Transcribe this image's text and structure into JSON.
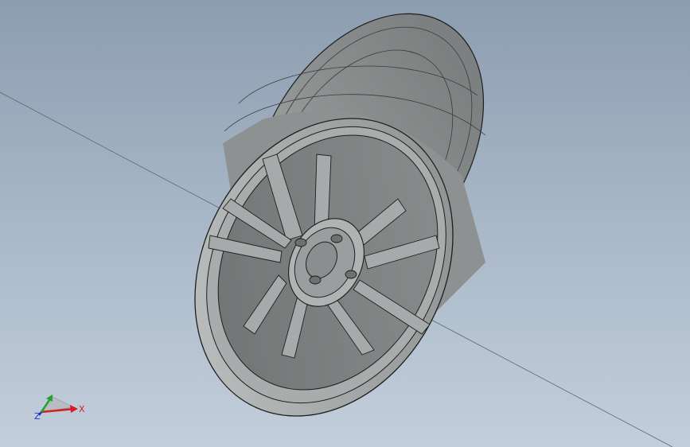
{
  "viewport": {
    "background_top": "#8c9db0",
    "background_bottom": "#c3cedb",
    "model_color": "#a3a6a6",
    "edge_color": "#1e1e1e"
  },
  "model": {
    "part": "wheel-rim",
    "spoke_count": 10,
    "bolt_holes": 4
  },
  "triad": {
    "x_label": "X",
    "y_label": "",
    "z_label": "Z",
    "x_color": "#d31f1f",
    "y_color": "#1ea52b",
    "z_color": "#2134c9"
  }
}
